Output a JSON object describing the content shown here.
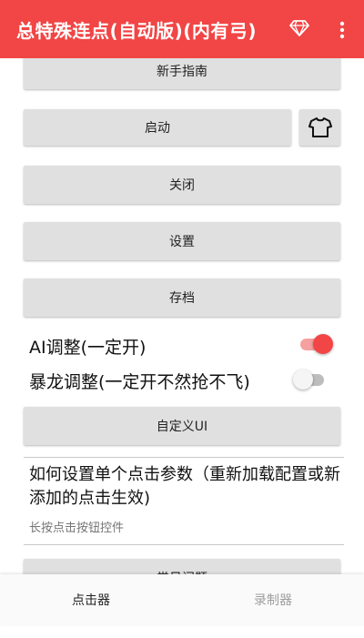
{
  "app_bar": {
    "title": "总特殊连点(自动版)(内有弓)",
    "background": "#f24545",
    "icons": [
      "gem-icon",
      "more-vert-icon"
    ]
  },
  "buttons": {
    "guide": "新手指南",
    "start": "启动",
    "close": "关闭",
    "settings": "设置",
    "save": "存档",
    "custom_ui": "自定义UI",
    "faq": "常见问题"
  },
  "toggles": [
    {
      "label": "AI调整(一定开)",
      "checked": true
    },
    {
      "label": "暴龙调整(一定开不然抢不飞)",
      "checked": false
    }
  ],
  "preference": {
    "title": "如何设置单个点击参数（重新加载配置或新添加的点击生效)",
    "summary": "长按点击按钮控件"
  },
  "bottom_nav": {
    "tabs": [
      {
        "label": "点击器",
        "active": true
      },
      {
        "label": "录制器",
        "active": false
      }
    ]
  },
  "colors": {
    "accent": "#f24545",
    "button_bg": "#e0e0e0"
  }
}
